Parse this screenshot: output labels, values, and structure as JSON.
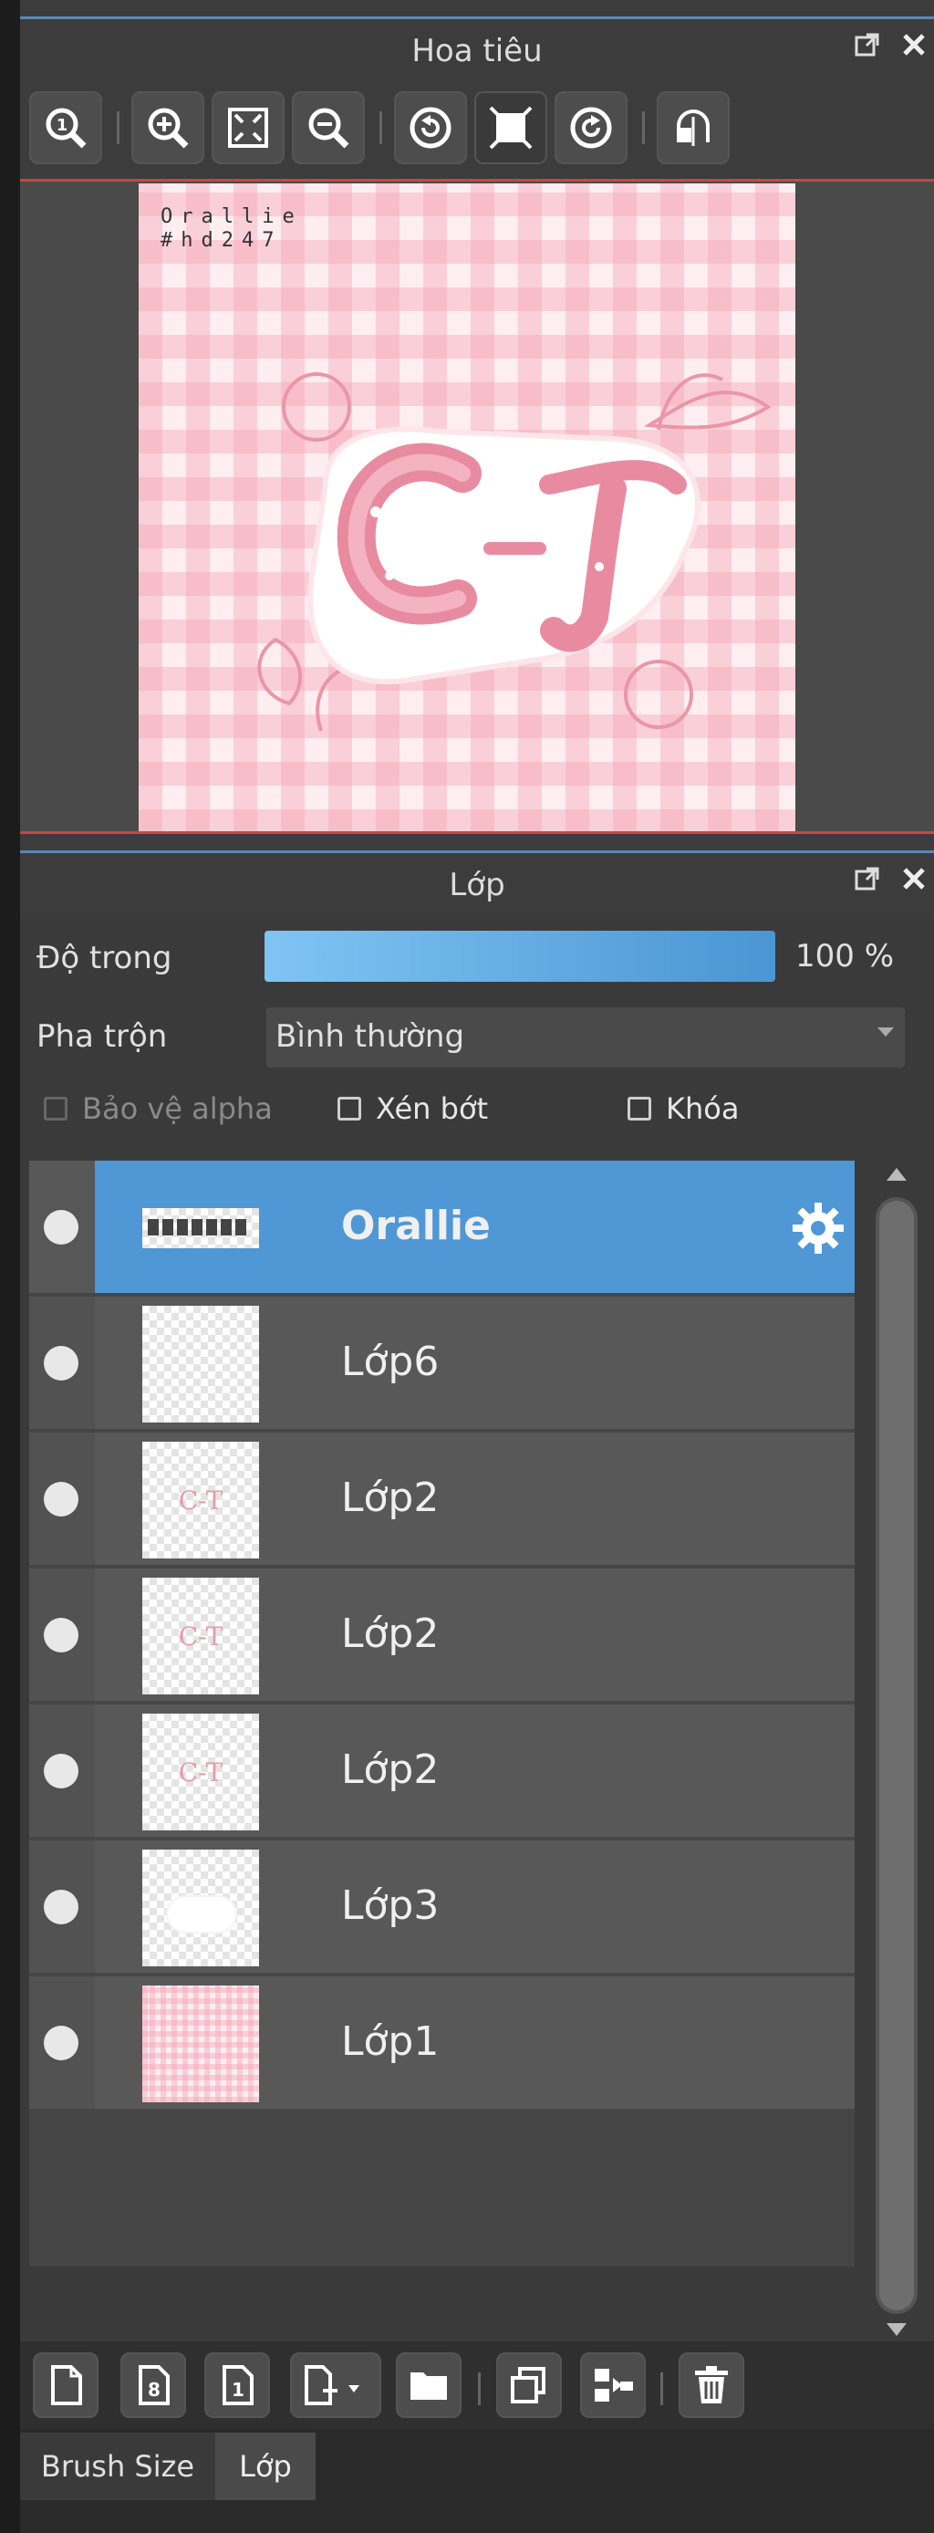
{
  "navigator": {
    "title": "Hoa tiêu",
    "toolbar": [
      {
        "icon": "zoom-100-icon"
      },
      {
        "icon": "zoom-in-icon"
      },
      {
        "icon": "fit-screen-icon"
      },
      {
        "icon": "zoom-out-icon"
      },
      {
        "icon": "rotate-left-icon"
      },
      {
        "icon": "reset-view-icon"
      },
      {
        "icon": "rotate-right-icon"
      },
      {
        "icon": "flip-horizontal-icon"
      }
    ],
    "canvas_text_line1": "Orallie",
    "canvas_text_line2": "#hd247"
  },
  "layer_panel": {
    "title": "Lớp",
    "opacity_label": "Độ trong",
    "opacity_value": "100 %",
    "opacity_level": 1.0,
    "blend_label": "Pha trộn",
    "blend_value": "Bình thường",
    "protect_alpha": "Bảo vệ alpha",
    "clipping": "Xén bớt",
    "lock": "Khóa",
    "layers": [
      {
        "name": "Orallie",
        "selected": true
      },
      {
        "name": "Lớp6"
      },
      {
        "name": "Lớp2"
      },
      {
        "name": "Lớp2"
      },
      {
        "name": "Lớp2"
      },
      {
        "name": "Lớp3"
      },
      {
        "name": "Lớp1"
      }
    ],
    "bottom_tools": [
      {
        "icon": "new-layer-icon"
      },
      {
        "icon": "new-8bit-layer-icon"
      },
      {
        "icon": "new-1bit-layer-icon"
      },
      {
        "icon": "add-layer-menu-icon"
      },
      {
        "icon": "folder-icon"
      },
      {
        "icon": "duplicate-layer-icon"
      },
      {
        "icon": "merge-down-icon"
      },
      {
        "icon": "delete-layer-icon"
      }
    ]
  },
  "tabs": [
    "Brush Size",
    "Lớp"
  ],
  "colors": {
    "accent": "#4f97d5",
    "panel": "#3a3a3a",
    "red_line": "#c24848",
    "blue_line": "#5b88b4"
  }
}
